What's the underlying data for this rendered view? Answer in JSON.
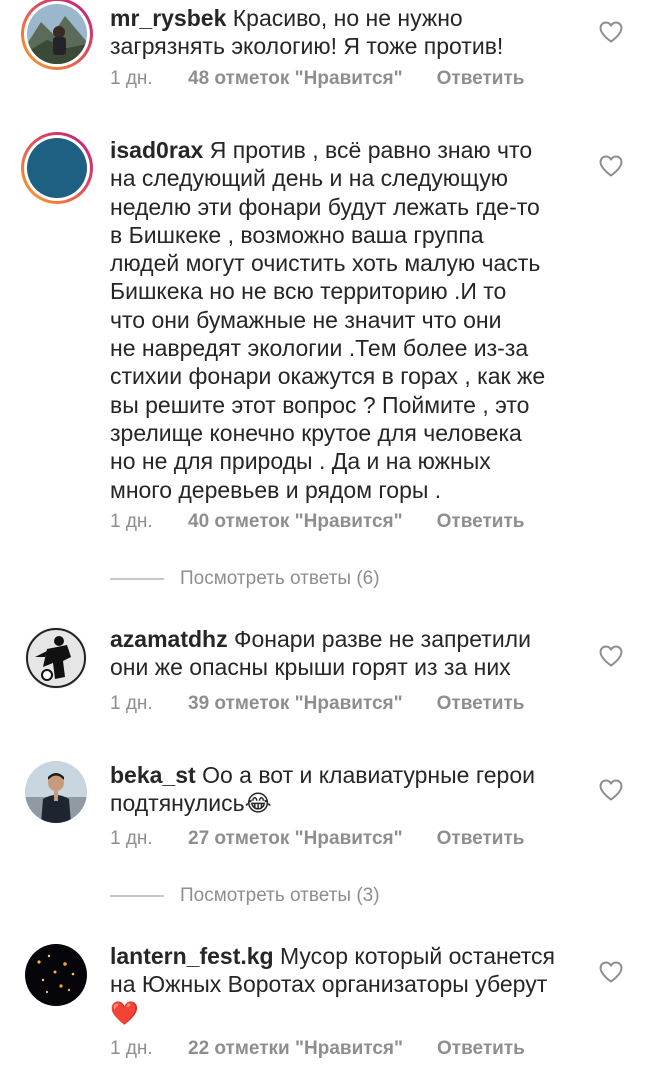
{
  "comments": [
    {
      "username": "mr_rysbek",
      "lines": [
        "Красиво, но не нужно",
        "загрязнять экологию! Я тоже против!"
      ],
      "time": "1 дн.",
      "likes": "48 отметок \"Нравится\"",
      "reply": "Ответить",
      "avatar": "avatar-mountain-photo",
      "story_ring": true
    },
    {
      "username": "isad0rax",
      "lines": [
        "Я против , всё равно знаю что",
        "на следующий день и на следующую",
        "неделю эти фонари будут лежать где-то",
        "в Бишкеке , возможно ваша группа",
        "людей могут очистить хоть малую часть",
        "Бишкека но не всю территорию .И то",
        "что они бумажные не значит что они",
        "не навредят экологии .Тем более из-за",
        "стихии фонари окажутся в горах , как же",
        "вы решите этот вопрос ? Поймите , это",
        "зрелище конечно крутое для человека",
        "но не для природы . Да и на южных",
        "много деревьев и рядом горы ."
      ],
      "time": "1 дн.",
      "likes": "40 отметок \"Нравится\"",
      "reply": "Ответить",
      "avatar": "avatar-teal-circle",
      "story_ring": true,
      "view_replies": "Посмотреть ответы (6)"
    },
    {
      "username": "azamatdhz",
      "lines": [
        "Фонари разве не запретили",
        "они же опасны крыши горят из за них"
      ],
      "time": "1 дн.",
      "likes": "39 отметок \"Нравится\"",
      "reply": "Ответить",
      "avatar": "avatar-football-player-sketch",
      "story_ring": false
    },
    {
      "username": "beka_st",
      "lines": [
        "Оо а вот и клавиатурные герои",
        "подтянулись😂"
      ],
      "time": "1 дн.",
      "likes": "27 отметок \"Нравится\"",
      "reply": "Ответить",
      "avatar": "avatar-person-photo",
      "story_ring": false,
      "view_replies": "Посмотреть ответы (3)"
    },
    {
      "username": "lantern_fest.kg",
      "lines": [
        "Мусор который останется",
        "на Южных Воротах организаторы уберут",
        "❤️"
      ],
      "time": "1 дн.",
      "likes": "22 отметки \"Нравится\"",
      "reply": "Ответить",
      "avatar": "avatar-night-lanterns",
      "story_ring": false
    }
  ],
  "icons": {
    "like": "heart-outline-icon"
  },
  "colors": {
    "text": "#262626",
    "meta": "#8e8e8e",
    "heart": "#8e8e8e"
  }
}
